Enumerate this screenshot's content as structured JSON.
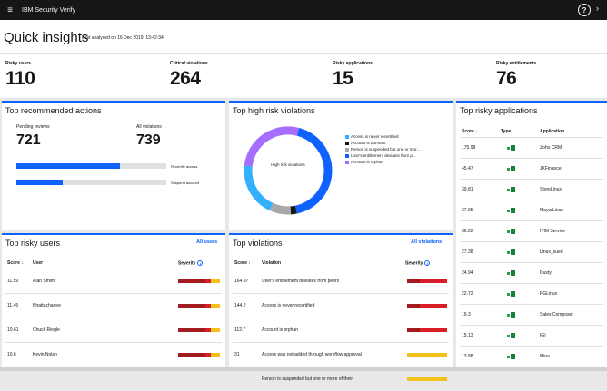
{
  "app": {
    "brand": "IBM Security Verify",
    "menu_icon": "hamburger-icon",
    "help_icon": "help-icon"
  },
  "header": {
    "title": "Quick insights",
    "analysed": "Last analysed on 16 Dec 2019, 13:42:34"
  },
  "kpis": [
    {
      "label": "Risky users",
      "value": "110"
    },
    {
      "label": "Critical violations",
      "value": "264"
    },
    {
      "label": "Risky applications",
      "value": "15"
    },
    {
      "label": "Risky entitlements",
      "value": "76"
    }
  ],
  "actions": {
    "title": "Top recommended actions",
    "pending_label": "Pending reviews",
    "pending_value": "721",
    "violations_label": "All violations",
    "violations_value": "739",
    "bars": [
      {
        "label": "Recertify access",
        "fill": 0.69
      },
      {
        "label": "Suspend account",
        "fill": 0.31
      }
    ]
  },
  "violations_chart": {
    "title": "Top high risk violations",
    "center_label": "High risk violations",
    "legend": [
      {
        "label": "Access is never recertified",
        "color": "#33b1ff"
      },
      {
        "label": "Account is dormant",
        "color": "#161616"
      },
      {
        "label": "Person is suspended but one or mor...",
        "color": "#a8a8a8"
      },
      {
        "label": "User's entitlement deviates from p...",
        "color": "#0f62fe"
      },
      {
        "label": "Account is orphan",
        "color": "#a56eff"
      }
    ],
    "colors": {
      "cyan": "#33b1ff",
      "blue": "#0f62fe",
      "purple": "#a56eff",
      "gray": "#a8a8a8",
      "black": "#161616"
    }
  },
  "apps": {
    "title": "Top risky applications",
    "headers": {
      "score": "Score",
      "type": "Type",
      "application": "Application"
    },
    "rows": [
      {
        "score": "175.98",
        "name": "Zoho CRM"
      },
      {
        "score": "45.47",
        "name": "JKFinance"
      },
      {
        "score": "39.81",
        "name": "StoreLinux"
      },
      {
        "score": "37.95",
        "name": "MayurLinux"
      },
      {
        "score": "36.22",
        "name": "ITIM Service"
      },
      {
        "score": "27.38",
        "name": "Linux_sued"
      },
      {
        "score": "24.94",
        "name": "Dusty"
      },
      {
        "score": "22.72",
        "name": "PGLinux"
      },
      {
        "score": "19.3",
        "name": "Sales Composer"
      },
      {
        "score": "15.13",
        "name": "IGI"
      },
      {
        "score": "13.88",
        "name": "Mina"
      }
    ]
  },
  "users": {
    "title": "Top risky users",
    "link": "All users",
    "headers": {
      "score": "Score",
      "user": "User",
      "severity": "Severity"
    },
    "rows": [
      {
        "score": "11.59",
        "name": "Alan Smith"
      },
      {
        "score": "11.45",
        "name": "Bhattacharjee"
      },
      {
        "score": "10.61",
        "name": "Chuck Riegle"
      },
      {
        "score": "10.6",
        "name": "Kevin Nolan"
      }
    ]
  },
  "violations": {
    "title": "Top violations",
    "link": "All violations",
    "headers": {
      "score": "Score",
      "violation": "Violation",
      "severity": "Severity"
    },
    "rows": [
      {
        "score": "164.97",
        "name": "User's entitlement deviates from peers",
        "sev": "red"
      },
      {
        "score": "144.2",
        "name": "Access is never recertified",
        "sev": "red"
      },
      {
        "score": "112.7",
        "name": "Account is orphan",
        "sev": "red"
      },
      {
        "score": "31",
        "name": "Access was not added through workflow approval",
        "sev": "yellow"
      },
      {
        "score": "",
        "name": "Person is suspended but one or more of their",
        "sev": "yellow"
      }
    ]
  }
}
